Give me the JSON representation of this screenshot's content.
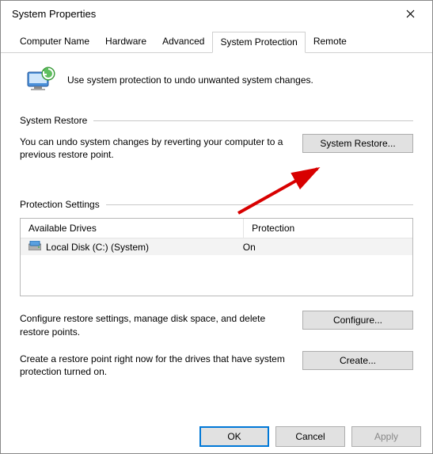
{
  "window": {
    "title": "System Properties"
  },
  "tabs": {
    "computer_name": "Computer Name",
    "hardware": "Hardware",
    "advanced": "Advanced",
    "system_protection": "System Protection",
    "remote": "Remote"
  },
  "intro": {
    "text": "Use system protection to undo unwanted system changes."
  },
  "restore": {
    "heading": "System Restore",
    "desc": "You can undo system changes by reverting your computer to a previous restore point.",
    "button": "System Restore..."
  },
  "protection": {
    "heading": "Protection Settings",
    "col_drives": "Available Drives",
    "col_protection": "Protection",
    "drive_name": "Local Disk (C:) (System)",
    "drive_status": "On",
    "configure_desc": "Configure restore settings, manage disk space, and delete restore points.",
    "configure_button": "Configure...",
    "create_desc": "Create a restore point right now for the drives that have system protection turned on.",
    "create_button": "Create..."
  },
  "footer": {
    "ok": "OK",
    "cancel": "Cancel",
    "apply": "Apply"
  }
}
